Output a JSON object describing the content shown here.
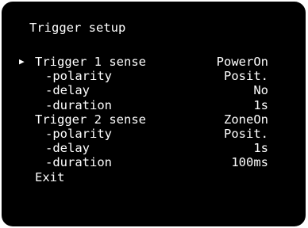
{
  "screen": {
    "title": "Trigger setup",
    "colors": {
      "background": "#000000",
      "text": "#ffffff"
    },
    "cursor_icon": "triangle-right-icon",
    "selected_index": 0,
    "items": [
      {
        "label": "Trigger 1 sense",
        "value": "PowerOn",
        "level": 0
      },
      {
        "label": "-polarity",
        "value": "Posit.",
        "level": 1
      },
      {
        "label": "-delay",
        "value": "No",
        "level": 1
      },
      {
        "label": "-duration",
        "value": "1s",
        "level": 1
      },
      {
        "label": "Trigger 2 sense",
        "value": "ZoneOn",
        "level": 0
      },
      {
        "label": "-polarity",
        "value": "Posit.",
        "level": 1
      },
      {
        "label": "-delay",
        "value": "1s",
        "level": 1
      },
      {
        "label": "-duration",
        "value": "100ms",
        "level": 1
      },
      {
        "label": "Exit",
        "value": "",
        "level": 0
      }
    ]
  }
}
